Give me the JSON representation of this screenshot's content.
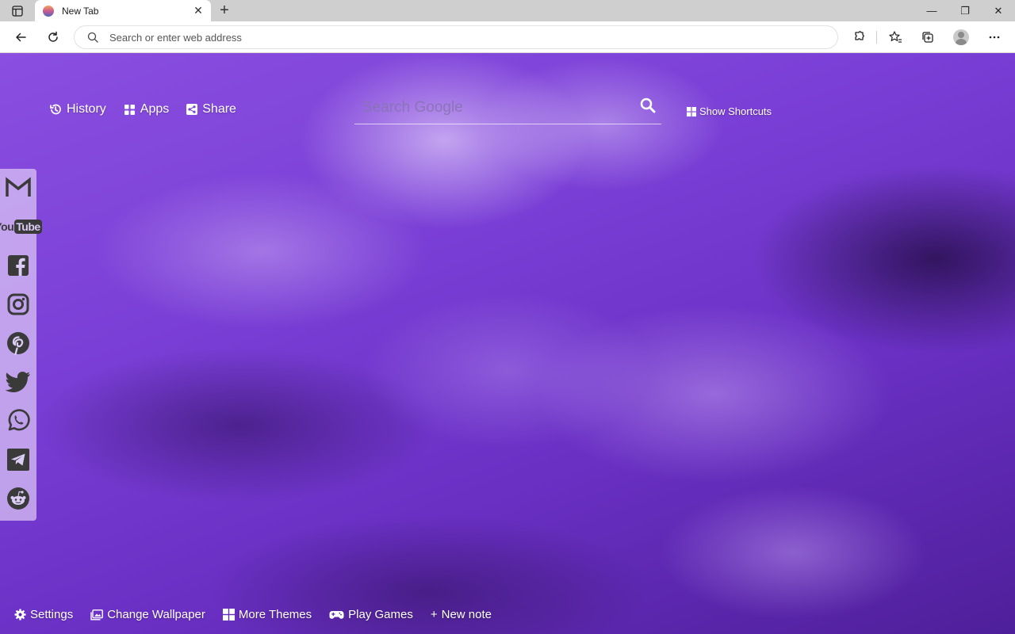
{
  "browser": {
    "tab": {
      "title": "New Tab"
    },
    "new_tab_label": "+",
    "window_controls": {
      "minimize": "—",
      "maximize": "❐",
      "close": "✕"
    },
    "address_bar": {
      "placeholder": "Search or enter web address",
      "value": ""
    }
  },
  "newtab": {
    "top_links": [
      {
        "label": "History",
        "icon": "history-icon"
      },
      {
        "label": "Apps",
        "icon": "apps-grid-icon"
      },
      {
        "label": "Share",
        "icon": "share-icon"
      }
    ],
    "search": {
      "placeholder": "Search Google",
      "value": ""
    },
    "show_shortcuts": {
      "label": "Show Shortcuts",
      "icon": "windows-grid-icon"
    },
    "social_links": [
      {
        "name": "Gmail",
        "icon": "gmail-icon"
      },
      {
        "name": "YouTube",
        "icon": "youtube-icon",
        "text_you": "You",
        "text_tube": "Tube"
      },
      {
        "name": "Facebook",
        "icon": "facebook-icon"
      },
      {
        "name": "Instagram",
        "icon": "instagram-icon"
      },
      {
        "name": "Pinterest",
        "icon": "pinterest-icon"
      },
      {
        "name": "Twitter",
        "icon": "twitter-icon"
      },
      {
        "name": "WhatsApp",
        "icon": "whatsapp-icon"
      },
      {
        "name": "Telegram",
        "icon": "telegram-icon"
      },
      {
        "name": "Reddit",
        "icon": "reddit-icon"
      }
    ],
    "bottom_bar": [
      {
        "label": "Settings",
        "icon": "gear-icon"
      },
      {
        "label": "Change Wallpaper",
        "icon": "wallpaper-icon"
      },
      {
        "label": "More Themes",
        "icon": "windows-grid-icon"
      },
      {
        "label": "Play Games",
        "icon": "gamepad-icon"
      },
      {
        "label": "New note",
        "prefix": "+"
      }
    ]
  },
  "colors": {
    "wallpaper_accent": "#7a3fd6",
    "sidebar_bg": "#dcc8f5",
    "sidebar_icon": "#3a3a3a"
  }
}
